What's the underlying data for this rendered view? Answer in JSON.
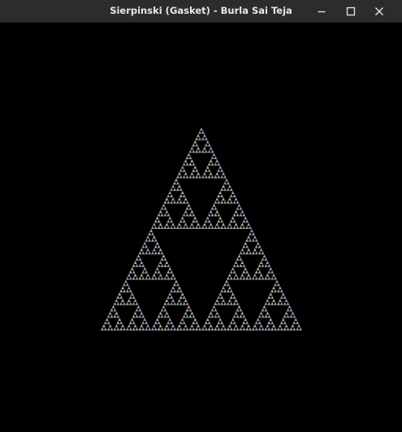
{
  "window": {
    "title": "Sierpinski (Gasket) - Burla Sai Teja"
  },
  "icons": {
    "minimize": "minimize-icon",
    "maximize": "maximize-icon",
    "close": "close-icon"
  },
  "colors": {
    "titlebar": "#2c2c2c",
    "title_text": "#e8e8e8",
    "canvas_background": "#000000",
    "fractal_palette": [
      "#c9a7cf",
      "#8fb8a0",
      "#a4b0d6",
      "#d4c8a8",
      "#9bd0c8",
      "#c8a0a8"
    ]
  }
}
